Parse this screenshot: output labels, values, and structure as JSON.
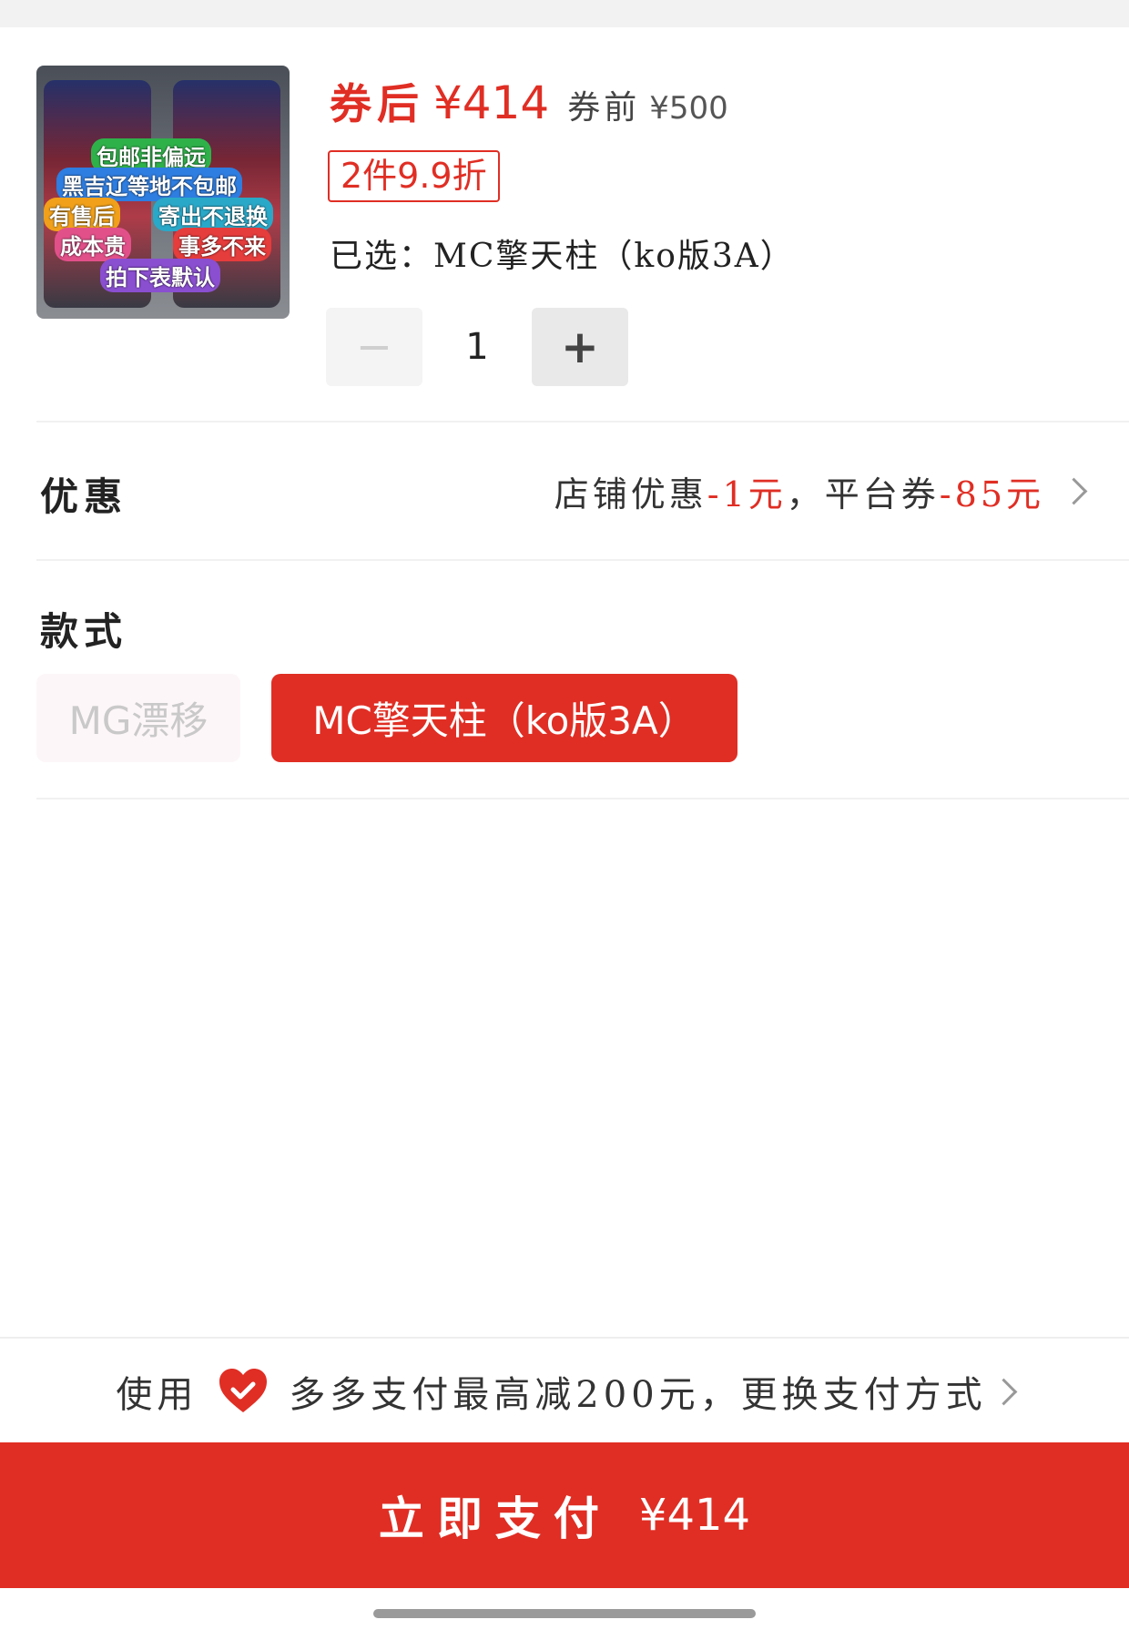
{
  "product": {
    "thumbnail_stickers": [
      "包邮非偏远",
      "黑吉辽等地不包邮",
      "有售后",
      "寄出不退换",
      "成本贵",
      "事多不来",
      "拍下表默认"
    ],
    "price_after_label": "券后",
    "price_after": "¥414",
    "price_before_label": "券前",
    "price_before": "¥500",
    "promo_tag": "2件9.9折",
    "selected_text": "已选：MC擎天柱（ko版3A）",
    "quantity": "1",
    "minus_symbol": "−",
    "plus_symbol": "+"
  },
  "discount": {
    "label": "优惠",
    "shop_label": "店铺优惠",
    "shop_value": "-1元",
    "sep": "，",
    "platform_label": "平台券",
    "platform_value": "-85元"
  },
  "style": {
    "label": "款式",
    "options": [
      "MG漂移",
      "MC擎天柱（ko版3A）"
    ],
    "selected_index": 1
  },
  "payment": {
    "prefix": "使用",
    "text": "多多支付最高减200元，更换支付方式"
  },
  "pay_button": {
    "label": "立即支付",
    "price": "¥414"
  },
  "colors": {
    "accent": "#e02e24",
    "disabled_text": "#c9c9c9"
  }
}
